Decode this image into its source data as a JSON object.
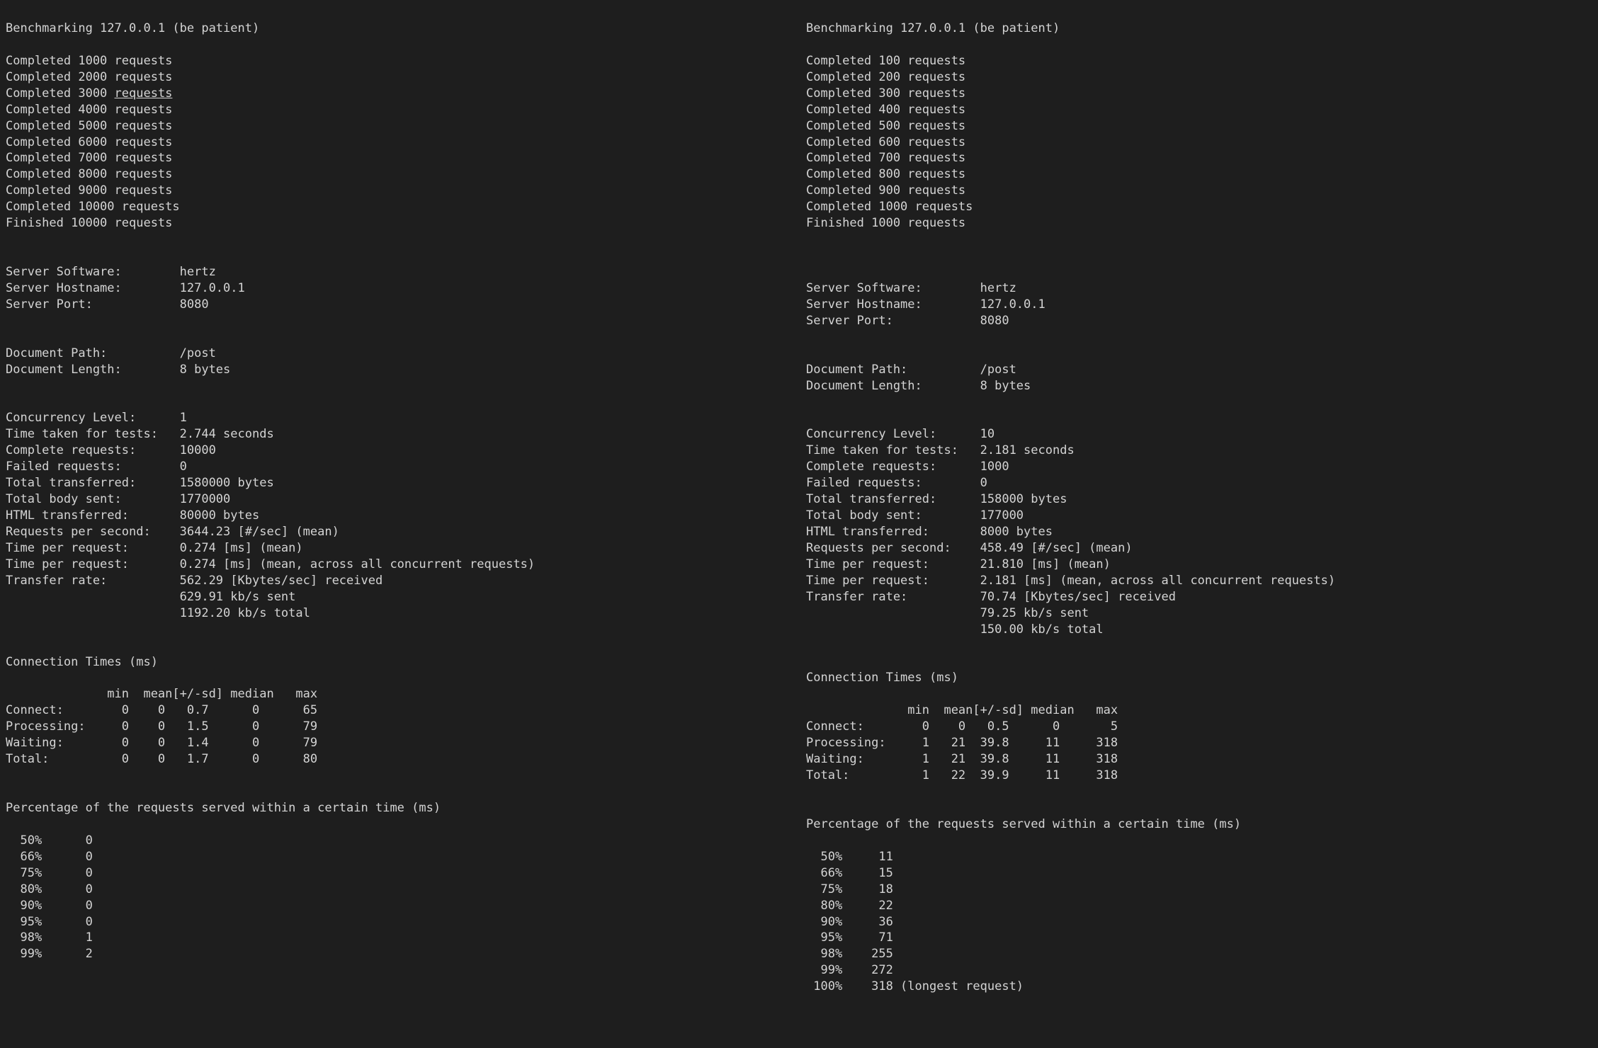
{
  "left": {
    "header": "Benchmarking 127.0.0.1 (be patient)",
    "progress": [
      "Completed 1000 requests",
      "Completed 2000 requests",
      "Completed 3000 requests",
      "Completed 4000 requests",
      "Completed 5000 requests",
      "Completed 6000 requests",
      "Completed 7000 requests",
      "Completed 8000 requests",
      "Completed 9000 requests",
      "Completed 10000 requests",
      "Finished 10000 requests"
    ],
    "progress_underlined_index": 2,
    "progress_underlined_prefix": "Completed 3000 ",
    "progress_underlined_word": "requests",
    "server_info": "Server Software:        hertz\nServer Hostname:        127.0.0.1\nServer Port:            8080",
    "doc_info": "Document Path:          /post\nDocument Length:        8 bytes",
    "stats": "Concurrency Level:      1\nTime taken for tests:   2.744 seconds\nComplete requests:      10000\nFailed requests:        0\nTotal transferred:      1580000 bytes\nTotal body sent:        1770000\nHTML transferred:       80000 bytes\nRequests per second:    3644.23 [#/sec] (mean)\nTime per request:       0.274 [ms] (mean)\nTime per request:       0.274 [ms] (mean, across all concurrent requests)\nTransfer rate:          562.29 [Kbytes/sec] received\n                        629.91 kb/s sent\n                        1192.20 kb/s total",
    "conn_header": "Connection Times (ms)",
    "conn_table": "              min  mean[+/-sd] median   max\nConnect:        0    0   0.7      0      65\nProcessing:     0    0   1.5      0      79\nWaiting:        0    0   1.4      0      79\nTotal:          0    0   1.7      0      80",
    "pct_header": "Percentage of the requests served within a certain time (ms)",
    "pct_table": "  50%      0\n  66%      0\n  75%      0\n  80%      0\n  90%      0\n  95%      0\n  98%      1\n  99%      2"
  },
  "right": {
    "header": "Benchmarking 127.0.0.1 (be patient)",
    "progress": "Completed 100 requests\nCompleted 200 requests\nCompleted 300 requests\nCompleted 400 requests\nCompleted 500 requests\nCompleted 600 requests\nCompleted 700 requests\nCompleted 800 requests\nCompleted 900 requests\nCompleted 1000 requests\nFinished 1000 requests",
    "server_info": "Server Software:        hertz\nServer Hostname:        127.0.0.1\nServer Port:            8080",
    "doc_info": "Document Path:          /post\nDocument Length:        8 bytes",
    "stats": "Concurrency Level:      10\nTime taken for tests:   2.181 seconds\nComplete requests:      1000\nFailed requests:        0\nTotal transferred:      158000 bytes\nTotal body sent:        177000\nHTML transferred:       8000 bytes\nRequests per second:    458.49 [#/sec] (mean)\nTime per request:       21.810 [ms] (mean)\nTime per request:       2.181 [ms] (mean, across all concurrent requests)\nTransfer rate:          70.74 [Kbytes/sec] received\n                        79.25 kb/s sent\n                        150.00 kb/s total",
    "conn_header": "Connection Times (ms)",
    "conn_table": "              min  mean[+/-sd] median   max\nConnect:        0    0   0.5      0       5\nProcessing:     1   21  39.8     11     318\nWaiting:        1   21  39.8     11     318\nTotal:          1   22  39.9     11     318",
    "pct_header": "Percentage of the requests served within a certain time (ms)",
    "pct_table": "  50%     11\n  66%     15\n  75%     18\n  80%     22\n  90%     36\n  95%     71\n  98%    255\n  99%    272\n 100%    318 (longest request)"
  }
}
